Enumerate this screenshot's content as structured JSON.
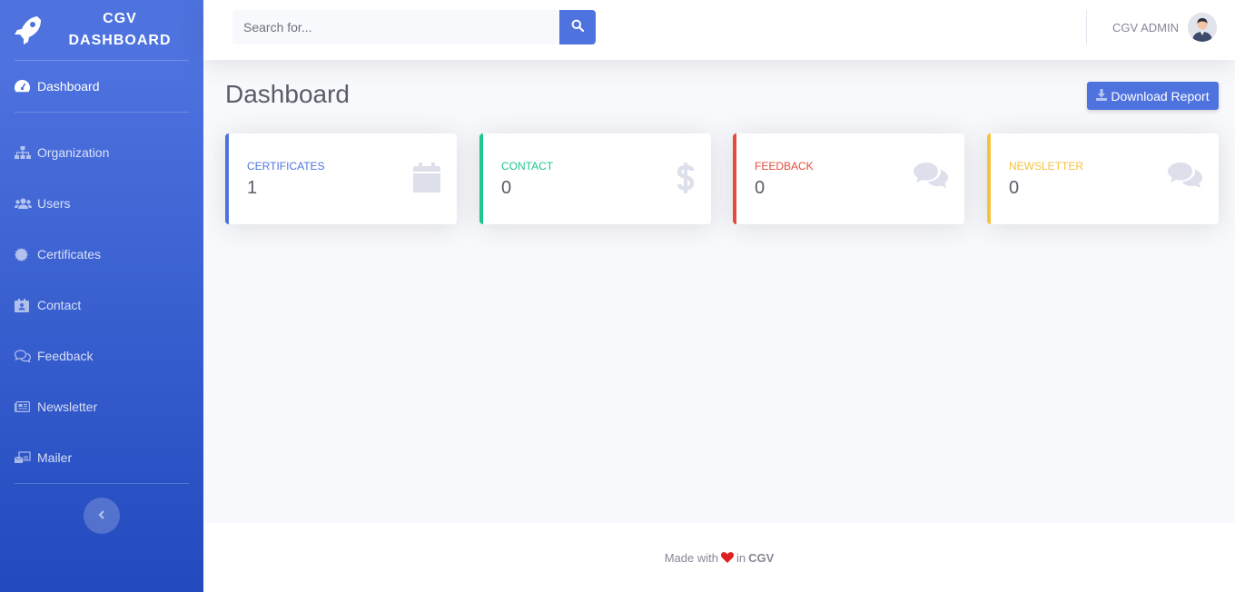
{
  "sidebar": {
    "brand": {
      "line1": "CGV",
      "line2": "DASHBOARD",
      "icon": "rocket-icon"
    },
    "active": {
      "label": "Dashboard",
      "icon": "tachometer-icon"
    },
    "items": [
      {
        "label": "Organization",
        "icon": "sitemap-icon"
      },
      {
        "label": "Users",
        "icon": "users-icon"
      },
      {
        "label": "Certificates",
        "icon": "certificate-icon"
      },
      {
        "label": "Contact",
        "icon": "address-book-icon"
      },
      {
        "label": "Feedback",
        "icon": "comments-icon"
      },
      {
        "label": "Newsletter",
        "icon": "newspaper-icon"
      },
      {
        "label": "Mailer",
        "icon": "mail-bulk-icon"
      }
    ]
  },
  "topbar": {
    "search": {
      "placeholder": "Search for..."
    },
    "user": {
      "name": "CGV ADMIN"
    }
  },
  "main": {
    "title": "Dashboard",
    "download_label": "Download Report",
    "cards": [
      {
        "label": "CERTIFICATES",
        "value": "1",
        "color": "#4e73df",
        "label_color": "#4e73df",
        "icon": "calendar-icon"
      },
      {
        "label": "CONTACT",
        "value": "0",
        "color": "#1cc88a",
        "label_color": "#1cc88a",
        "icon": "dollar-icon"
      },
      {
        "label": "FEEDBACK",
        "value": "0",
        "color": "#e74a3b",
        "label_color": "#e74a3b",
        "icon": "comments-icon"
      },
      {
        "label": "NEWSLETTER",
        "value": "0",
        "color": "#f6c23e",
        "label_color": "#f6c23e",
        "icon": "comments-icon"
      }
    ]
  },
  "footer": {
    "prefix": "Made with",
    "middle": "in",
    "brand": "CGV"
  },
  "colors": {
    "primary": "#4e73df",
    "icon_gray": "#dddfeb"
  }
}
